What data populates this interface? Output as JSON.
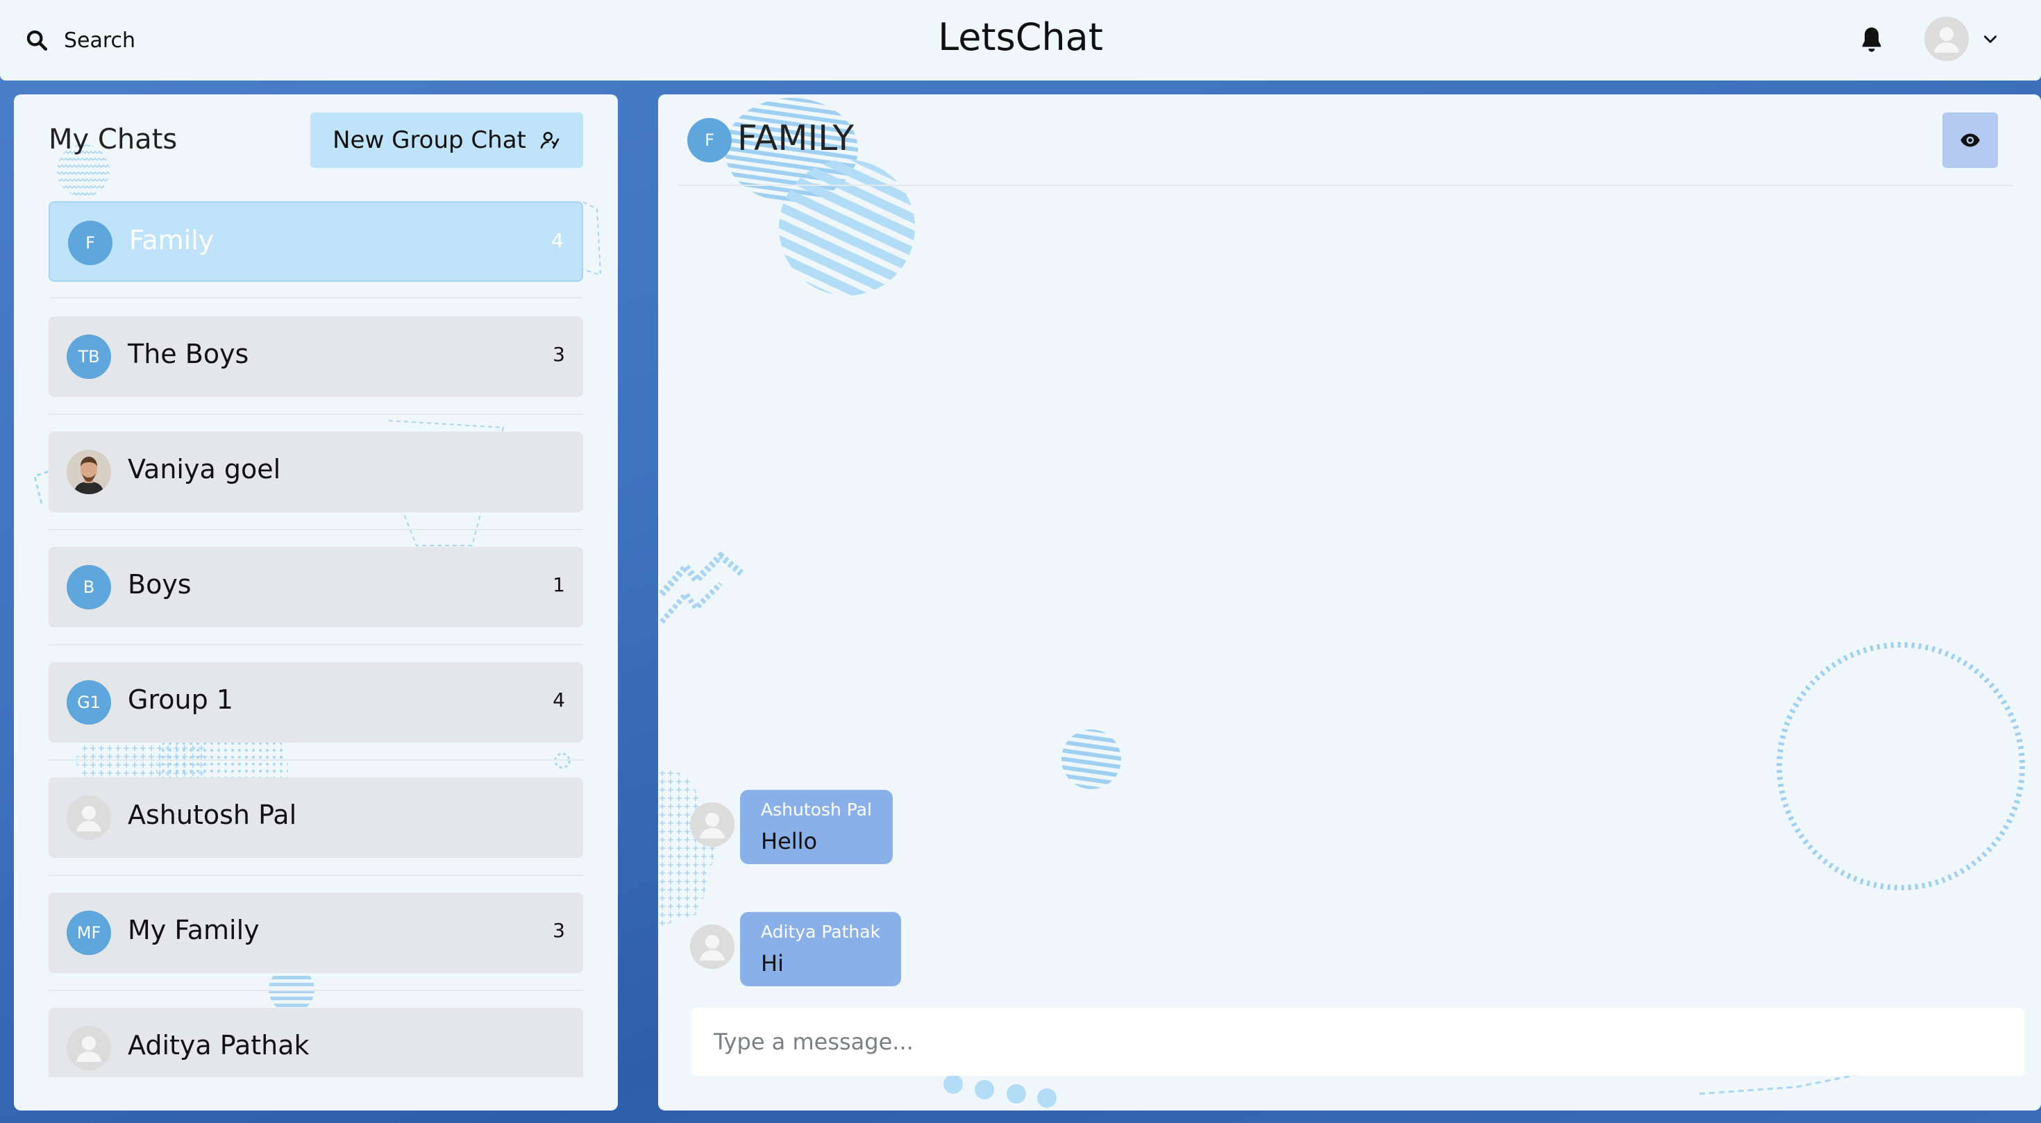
{
  "header": {
    "search_label": "Search",
    "app_title": "LetsChat",
    "icons": {
      "search": "search-icon",
      "bell": "bell-icon",
      "profile": "user-avatar",
      "dropdown": "chevron-down-icon"
    }
  },
  "sidebar": {
    "title": "My Chats",
    "new_group_label": "New Group Chat",
    "new_group_icon": "add-group-icon",
    "chats": [
      {
        "initials": "F",
        "name": "Family",
        "count": "4",
        "avatar": "initials",
        "active": true
      },
      {
        "initials": "TB",
        "name": "The Boys",
        "count": "3",
        "avatar": "initials",
        "active": false
      },
      {
        "initials": "",
        "name": "Vaniya goel",
        "count": "",
        "avatar": "photo",
        "active": false
      },
      {
        "initials": "B",
        "name": "Boys",
        "count": "1",
        "avatar": "initials",
        "active": false
      },
      {
        "initials": "G1",
        "name": "Group 1",
        "count": "4",
        "avatar": "initials",
        "active": false
      },
      {
        "initials": "",
        "name": "Ashutosh Pal",
        "count": "",
        "avatar": "blank",
        "active": false
      },
      {
        "initials": "MF",
        "name": "My Family",
        "count": "3",
        "avatar": "initials",
        "active": false
      },
      {
        "initials": "",
        "name": "Aditya Pathak",
        "count": "",
        "avatar": "blank",
        "active": false
      }
    ]
  },
  "chat": {
    "avatar_initial": "F",
    "title": "FAMILY",
    "view_icon": "eye-icon",
    "messages": [
      {
        "sender": "Ashutosh Pal",
        "text": "Hello"
      },
      {
        "sender": "Aditya Pathak",
        "text": "Hi"
      }
    ],
    "composer_placeholder": "Type a message..."
  },
  "colors": {
    "background_blue": "#3d72bd",
    "panel": "#f0f7fb",
    "active_chat": "#bfe3f9",
    "chat_item": "#e4e6ea",
    "avatar_blue": "#5fa6dc",
    "bubble": "#8ab0ea",
    "eye_button": "#b3c9ef"
  }
}
